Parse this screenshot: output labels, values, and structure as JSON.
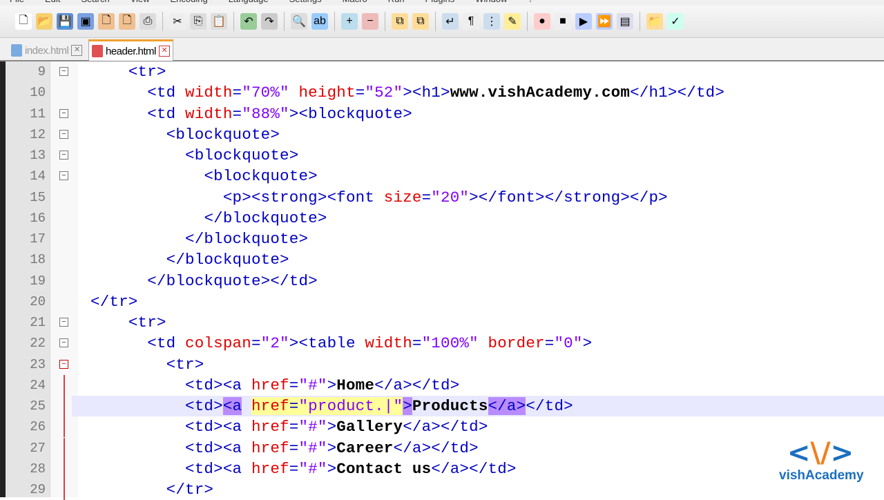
{
  "menu": [
    "File",
    "Edit",
    "Search",
    "View",
    "Encoding",
    "Language",
    "Settings",
    "Macro",
    "Run",
    "Plugins",
    "Window",
    "?"
  ],
  "toolbar": [
    {
      "icon": "new-file-icon",
      "glyph": "🗋",
      "color": "#fff"
    },
    {
      "icon": "open-file-icon",
      "glyph": "📂",
      "color": "#f5d070"
    },
    {
      "icon": "save-icon",
      "glyph": "💾",
      "color": "#5b8fd8"
    },
    {
      "icon": "save-all-icon",
      "glyph": "▣",
      "color": "#7aa0e0"
    },
    {
      "icon": "close-icon",
      "glyph": "🗋",
      "color": "#f0c090"
    },
    {
      "icon": "close-all-icon",
      "glyph": "🗋",
      "color": "#f0c090"
    },
    {
      "icon": "print-icon",
      "glyph": "⎙",
      "color": "#ddd"
    },
    {
      "sep": true
    },
    {
      "icon": "cut-icon",
      "glyph": "✂",
      "color": "#eee"
    },
    {
      "icon": "copy-icon",
      "glyph": "⎘",
      "color": "#ddd"
    },
    {
      "icon": "paste-icon",
      "glyph": "📋",
      "color": "#ddd"
    },
    {
      "sep": true
    },
    {
      "icon": "undo-icon",
      "glyph": "↶",
      "color": "#9c9"
    },
    {
      "icon": "redo-icon",
      "glyph": "↷",
      "color": "#ccc"
    },
    {
      "sep": true
    },
    {
      "icon": "find-icon",
      "glyph": "🔍",
      "color": "#ddd"
    },
    {
      "icon": "replace-icon",
      "glyph": "ab",
      "color": "#9cf"
    },
    {
      "sep": true
    },
    {
      "icon": "zoom-in-icon",
      "glyph": "+",
      "color": "#bde"
    },
    {
      "icon": "zoom-out-icon",
      "glyph": "−",
      "color": "#ebb"
    },
    {
      "sep": true
    },
    {
      "icon": "sync-vertical-icon",
      "glyph": "⧉",
      "color": "#fd9"
    },
    {
      "icon": "sync-horizontal-icon",
      "glyph": "⧉",
      "color": "#fd9"
    },
    {
      "sep": true
    },
    {
      "icon": "word-wrap-icon",
      "glyph": "↵",
      "color": "#cde"
    },
    {
      "icon": "show-all-chars-icon",
      "glyph": "¶",
      "color": "#eee"
    },
    {
      "icon": "indent-guide-icon",
      "glyph": "⋮",
      "color": "#cde"
    },
    {
      "icon": "user-lang-icon",
      "glyph": "✎",
      "color": "#fe9"
    },
    {
      "sep": true
    },
    {
      "icon": "record-macro-icon",
      "glyph": "●",
      "color": "#fcc"
    },
    {
      "icon": "stop-macro-icon",
      "glyph": "■",
      "color": "#eee"
    },
    {
      "icon": "play-macro-icon",
      "glyph": "▶",
      "color": "#bcf"
    },
    {
      "icon": "run-macro-multiple-icon",
      "glyph": "⏩",
      "color": "#bcf"
    },
    {
      "icon": "save-macro-icon",
      "glyph": "▤",
      "color": "#dde"
    },
    {
      "sep": true
    },
    {
      "icon": "folder-icon",
      "glyph": "📁",
      "color": "#fd9"
    },
    {
      "icon": "spellcheck-icon",
      "glyph": "✓",
      "color": "#cfe"
    }
  ],
  "tabs": [
    {
      "label": "index.html",
      "active": false
    },
    {
      "label": "header.html",
      "active": true
    }
  ],
  "lines": [
    {
      "n": "9",
      "fold": "box",
      "t": [
        [
          "ws",
          "    "
        ],
        [
          "tag",
          "<tr>"
        ]
      ]
    },
    {
      "n": "10",
      "t": [
        [
          "ws",
          "      "
        ],
        [
          "tag",
          "<td "
        ],
        [
          "attr",
          "width"
        ],
        [
          "tag",
          "="
        ],
        [
          "val",
          "\"70%\" "
        ],
        [
          "attr",
          "height"
        ],
        [
          "tag",
          "="
        ],
        [
          "val",
          "\"52\""
        ],
        [
          "tag",
          ">"
        ],
        [
          "tag",
          "<h1>"
        ],
        [
          "text",
          "www.vishAcademy.com"
        ],
        [
          "tag",
          "</h1></td>"
        ]
      ]
    },
    {
      "n": "11",
      "fold": "box",
      "t": [
        [
          "ws",
          "      "
        ],
        [
          "tag",
          "<td "
        ],
        [
          "attr",
          "width"
        ],
        [
          "tag",
          "="
        ],
        [
          "val",
          "\"88%\""
        ],
        [
          "tag",
          "><blockquote>"
        ]
      ]
    },
    {
      "n": "12",
      "fold": "box",
      "t": [
        [
          "ws",
          "        "
        ],
        [
          "tag",
          "<blockquote>"
        ]
      ]
    },
    {
      "n": "13",
      "fold": "box",
      "t": [
        [
          "ws",
          "          "
        ],
        [
          "tag",
          "<blockquote>"
        ]
      ]
    },
    {
      "n": "14",
      "fold": "box",
      "t": [
        [
          "ws",
          "            "
        ],
        [
          "tag",
          "<blockquote>"
        ]
      ]
    },
    {
      "n": "15",
      "t": [
        [
          "ws",
          "              "
        ],
        [
          "tag",
          "<p><strong><font "
        ],
        [
          "attr",
          "size"
        ],
        [
          "tag",
          "="
        ],
        [
          "val",
          "\"20\""
        ],
        [
          "tag",
          "></font></strong></p>"
        ]
      ]
    },
    {
      "n": "16",
      "t": [
        [
          "ws",
          "            "
        ],
        [
          "tag",
          "</blockquote>"
        ]
      ]
    },
    {
      "n": "17",
      "t": [
        [
          "ws",
          "          "
        ],
        [
          "tag",
          "</blockquote>"
        ]
      ]
    },
    {
      "n": "18",
      "t": [
        [
          "ws",
          "        "
        ],
        [
          "tag",
          "</blockquote>"
        ]
      ]
    },
    {
      "n": "19",
      "t": [
        [
          "ws",
          "      "
        ],
        [
          "tag",
          "</blockquote></td>"
        ]
      ]
    },
    {
      "n": "20",
      "t": [
        [
          "tag",
          "</tr>"
        ]
      ]
    },
    {
      "n": "21",
      "fold": "box",
      "t": [
        [
          "ws",
          "    "
        ],
        [
          "tag",
          "<tr>"
        ]
      ]
    },
    {
      "n": "22",
      "fold": "box",
      "t": [
        [
          "ws",
          "      "
        ],
        [
          "tag",
          "<td "
        ],
        [
          "attr",
          "colspan"
        ],
        [
          "tag",
          "="
        ],
        [
          "val",
          "\"2\""
        ],
        [
          "tag",
          "><table "
        ],
        [
          "attr",
          "width"
        ],
        [
          "tag",
          "="
        ],
        [
          "val",
          "\"100%\" "
        ],
        [
          "attr",
          "border"
        ],
        [
          "tag",
          "="
        ],
        [
          "val",
          "\"0\""
        ],
        [
          "tag",
          ">"
        ]
      ]
    },
    {
      "n": "23",
      "fold": "red",
      "t": [
        [
          "ws",
          "        "
        ],
        [
          "tag",
          "<tr>"
        ]
      ]
    },
    {
      "n": "24",
      "fold": "bar",
      "t": [
        [
          "ws",
          "          "
        ],
        [
          "tag",
          "<td><a "
        ],
        [
          "attr",
          "href"
        ],
        [
          "tag",
          "="
        ],
        [
          "val",
          "\"#\""
        ],
        [
          "tag",
          ">"
        ],
        [
          "text",
          "Home"
        ],
        [
          "tag",
          "</a></td>"
        ]
      ]
    },
    {
      "n": "25",
      "fold": "bar",
      "current": true,
      "t": [
        [
          "ws",
          "          "
        ],
        [
          "tag",
          "<td>"
        ],
        [
          "tag brace",
          "<a"
        ],
        [
          "tag",
          " "
        ],
        [
          "attr sel",
          "href"
        ],
        [
          "tag sel",
          "="
        ],
        [
          "val sel",
          "\"product.|\""
        ],
        [
          "tag brace",
          ">"
        ],
        [
          "text",
          "Products"
        ],
        [
          "tag brace",
          "</a>"
        ],
        [
          "tag",
          "</td>"
        ]
      ]
    },
    {
      "n": "26",
      "fold": "bar",
      "t": [
        [
          "ws",
          "          "
        ],
        [
          "tag",
          "<td><a "
        ],
        [
          "attr",
          "href"
        ],
        [
          "tag",
          "="
        ],
        [
          "val",
          "\"#\""
        ],
        [
          "tag",
          ">"
        ],
        [
          "text",
          "Gallery"
        ],
        [
          "tag",
          "</a></td>"
        ]
      ]
    },
    {
      "n": "27",
      "fold": "bar",
      "t": [
        [
          "ws",
          "          "
        ],
        [
          "tag",
          "<td><a "
        ],
        [
          "attr",
          "href"
        ],
        [
          "tag",
          "="
        ],
        [
          "val",
          "\"#\""
        ],
        [
          "tag",
          ">"
        ],
        [
          "text",
          "Career"
        ],
        [
          "tag",
          "</a></td>"
        ]
      ]
    },
    {
      "n": "28",
      "fold": "bar",
      "t": [
        [
          "ws",
          "          "
        ],
        [
          "tag",
          "<td><a "
        ],
        [
          "attr",
          "href"
        ],
        [
          "tag",
          "="
        ],
        [
          "val",
          "\"#\""
        ],
        [
          "tag",
          ">"
        ],
        [
          "text",
          "Contact us"
        ],
        [
          "tag",
          "</a></td>"
        ]
      ]
    },
    {
      "n": "29",
      "fold": "bar",
      "t": [
        [
          "ws",
          "        "
        ],
        [
          "tag",
          "</tr>"
        ]
      ]
    }
  ],
  "logo": {
    "mark": "<\\/>",
    "name": "vishAcademy"
  }
}
